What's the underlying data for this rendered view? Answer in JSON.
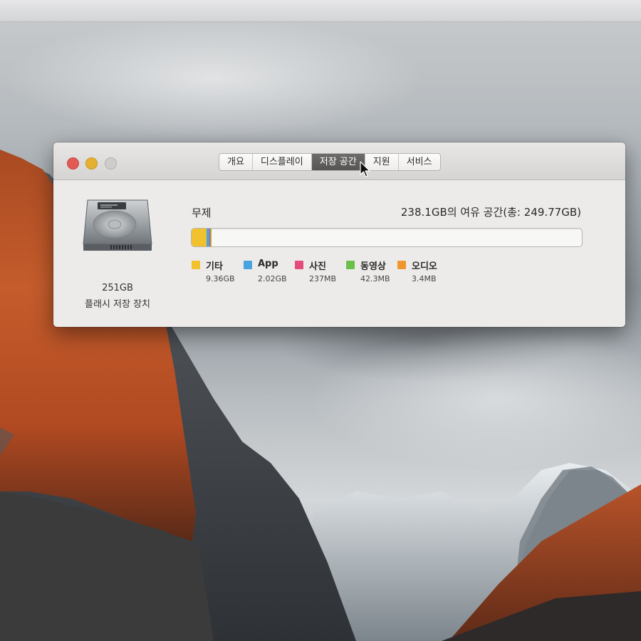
{
  "window": {
    "tabs": [
      {
        "label": "개요",
        "active": false
      },
      {
        "label": "디스플레이",
        "active": false
      },
      {
        "label": "저장 공간",
        "active": true
      },
      {
        "label": "지원",
        "active": false
      },
      {
        "label": "서비스",
        "active": false
      }
    ]
  },
  "drive": {
    "size": "251GB",
    "type": "플래시 저장 장치",
    "name": "무제",
    "free_space_text": "238.1GB의 여유 공간(총: 249.77GB)"
  },
  "storage": {
    "total_gb": 249.77,
    "categories": [
      {
        "label": "기타",
        "size": "9.36GB",
        "size_gb": 9.36,
        "color": "#f2c12e"
      },
      {
        "label": "App",
        "size": "2.02GB",
        "size_gb": 2.02,
        "color": "#4aa3df"
      },
      {
        "label": "사진",
        "size": "237MB",
        "size_gb": 0.237,
        "color": "#e44c7a"
      },
      {
        "label": "동영상",
        "size": "42.3MB",
        "size_gb": 0.0423,
        "color": "#6cc04a"
      },
      {
        "label": "오디오",
        "size": "3.4MB",
        "size_gb": 0.0034,
        "color": "#f0962e"
      }
    ]
  },
  "colors": {
    "close": "#e25a55",
    "minimize": "#e5b133",
    "zoom": "#cfcdcb",
    "active_tab": "#575553"
  }
}
